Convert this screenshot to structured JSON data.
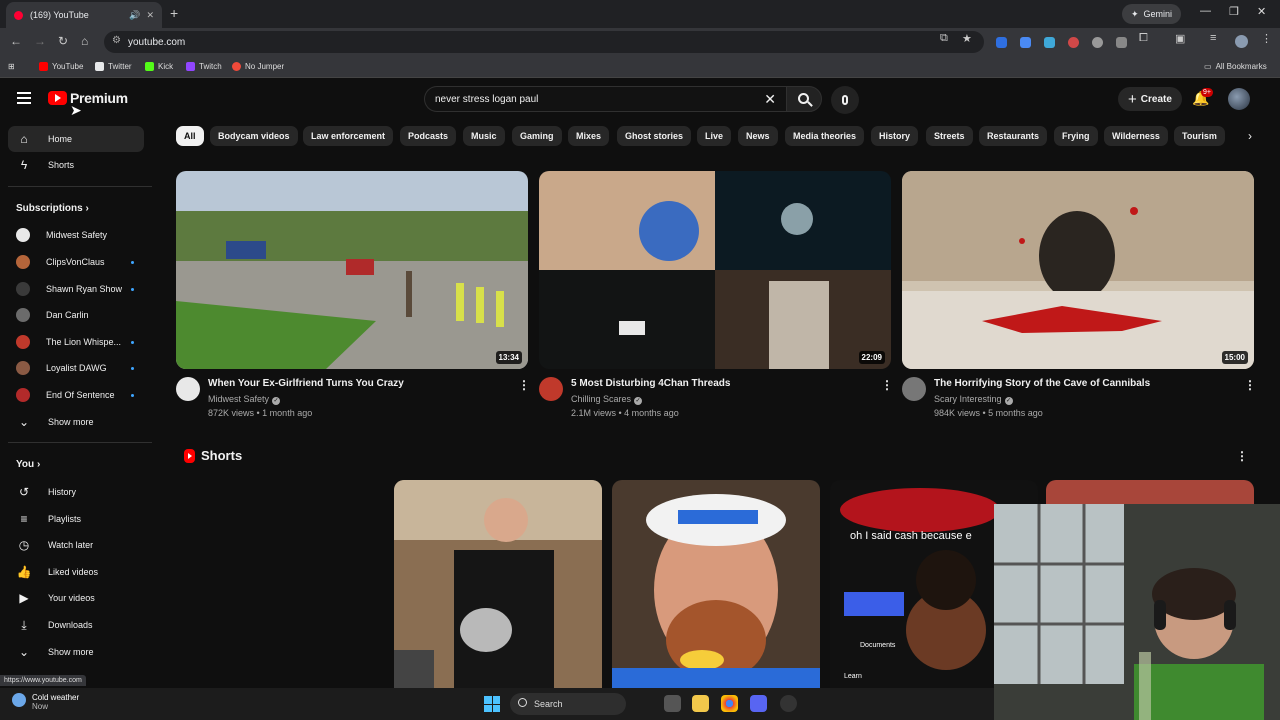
{
  "browser": {
    "tab_title": "(169) YouTube",
    "new_tab_label": "+",
    "gemini_label": "Gemini",
    "address": "youtube.com",
    "bookmarks": [
      {
        "label": "YouTube",
        "color": "#ff0000"
      },
      {
        "label": "Twitter",
        "color": "#e7e9ea"
      },
      {
        "label": "Kick",
        "color": "#53fc18"
      },
      {
        "label": "Twitch",
        "color": "#9146ff"
      },
      {
        "label": "No Jumper",
        "color": "#f04a3a"
      }
    ],
    "all_bookmarks": "All Bookmarks",
    "status_url": "https://www.youtube.com"
  },
  "header": {
    "logo_text": "Premium",
    "search_value": "never stress logan paul",
    "create_label": "Create",
    "notification_badge": "9+"
  },
  "sidebar": {
    "home": "Home",
    "shorts": "Shorts",
    "subscriptions_title": "Subscriptions",
    "subscriptions": [
      {
        "name": "Midwest Safety",
        "color": "#e8e8e8",
        "new": false
      },
      {
        "name": "ClipsVonClaus",
        "color": "#b5653a",
        "new": true
      },
      {
        "name": "Shawn Ryan Show",
        "color": "#3a3a3a",
        "new": true
      },
      {
        "name": "Dan Carlin",
        "color": "#6b6b6b",
        "new": false
      },
      {
        "name": "The Lion Whispe...",
        "color": "#c0392b",
        "new": true
      },
      {
        "name": "Loyalist DAWG",
        "color": "#8a5a44",
        "new": true
      },
      {
        "name": "End Of Sentence",
        "color": "#b22a2a",
        "new": true
      }
    ],
    "show_more_1": "Show more",
    "you_title": "You",
    "you_items": [
      "History",
      "Playlists",
      "Watch later",
      "Liked videos",
      "Your videos",
      "Downloads"
    ],
    "show_more_2": "Show more"
  },
  "chips": [
    "All",
    "Bodycam videos",
    "Law enforcement",
    "Podcasts",
    "Music",
    "Gaming",
    "Mixes",
    "Ghost stories",
    "Live",
    "News",
    "Media theories",
    "History",
    "Streets",
    "Restaurants",
    "Frying",
    "Wilderness",
    "Tourism"
  ],
  "videos": [
    {
      "title": "When Your Ex-Girlfriend Turns You Crazy",
      "channel": "Midwest Safety",
      "meta": "872K views • 1 month ago",
      "duration": "13:34",
      "avatar_color": "#e8e8e8"
    },
    {
      "title": "5 Most Disturbing 4Chan Threads",
      "channel": "Chilling Scares",
      "meta": "2.1M views • 4 months ago",
      "duration": "22:09",
      "avatar_color": "#c0392b"
    },
    {
      "title": "The Horrifying Story of the Cave of Cannibals",
      "channel": "Scary Interesting",
      "meta": "984K views • 5 months ago",
      "duration": "15:00",
      "avatar_color": "#777777"
    }
  ],
  "shorts": {
    "title": "Shorts",
    "overlay_caption": "oh I said cash because e",
    "overlay_documents": "Documents",
    "overlay_learn": "Learn"
  },
  "taskbar": {
    "weather_title": "Cold weather",
    "weather_sub": "Now",
    "search_label": "Search"
  }
}
